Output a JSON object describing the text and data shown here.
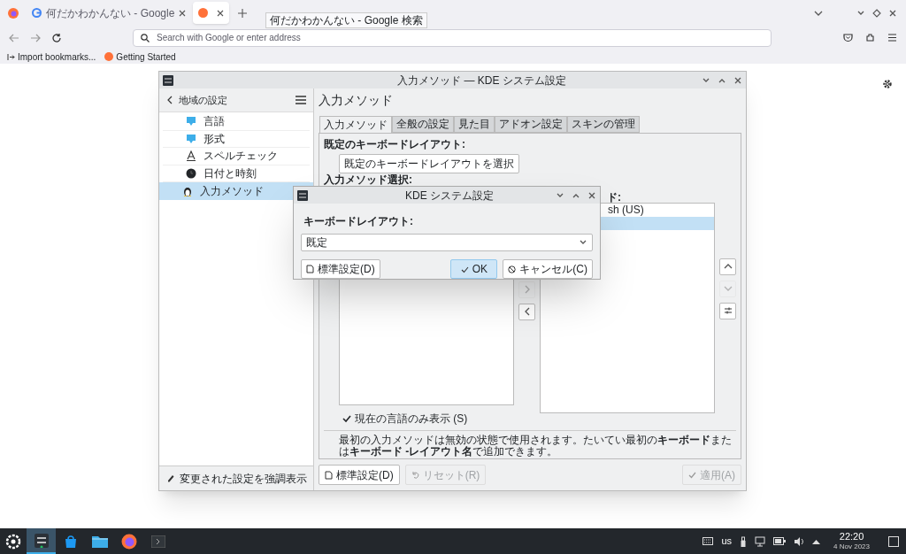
{
  "browser": {
    "tabs": [
      {
        "title": "何だかわかんない - Google",
        "selected": false
      },
      {
        "selected": true
      }
    ],
    "tooltip": "何だかわかんない - Google 検索",
    "address_bar": {
      "placeholder": "Search with Google or enter address"
    },
    "bookmarks": [
      "Import bookmarks...",
      "Getting Started"
    ]
  },
  "settings_window": {
    "title": "入力メソッド — KDE システム設定",
    "sidebar": {
      "title": "地域の設定",
      "items": [
        {
          "label": "言語",
          "kind": "speech",
          "selected": false
        },
        {
          "label": "形式",
          "kind": "speech",
          "selected": false
        },
        {
          "label": "スペルチェック",
          "kind": "spell",
          "selected": false
        },
        {
          "label": "日付と時刻",
          "kind": "clock",
          "selected": false
        },
        {
          "label": "入力メソッド",
          "kind": "penguin",
          "selected": true
        }
      ],
      "footer_button": "変更された設定を強調表示"
    },
    "page_title": "入力メソッド",
    "tabs": [
      {
        "label": "入力メソッド",
        "selected": true
      },
      {
        "label": "全般の設定",
        "selected": false
      },
      {
        "label": "見た目",
        "selected": false
      },
      {
        "label": "アドオン設定",
        "selected": false
      },
      {
        "label": "スキンの管理",
        "selected": false
      }
    ],
    "default_layout_label": "既定のキーボードレイアウト:",
    "select_layout_button": "既定のキーボードレイアウトを選択",
    "input_method_label": "入力メソッド選択:",
    "current_label": "ド:",
    "current_methods": [
      {
        "text": "sh (US)",
        "selected": false
      },
      {
        "selected": true
      }
    ],
    "add_button": {
      "disabled": true
    },
    "remove_button": {
      "disabled": false
    },
    "move_up_button": {
      "disabled": false
    },
    "move_down_button": {
      "disabled": true
    },
    "current_language_only": {
      "label": "現在の言語のみ表示 (S)",
      "checked": true
    },
    "info": "最初の入力メソッドは無効の状態で使用されます。たいてい最初の**キーボード**または**キーボード -レイアウト名**で追加できます。",
    "buttons": [
      {
        "label": "標準設定(D)",
        "kind": "defaults",
        "disabled": false
      },
      {
        "label": "リセット(R)",
        "kind": "reset",
        "disabled": true
      },
      {
        "label": "適用(A)",
        "kind": "apply",
        "disabled": true
      }
    ]
  },
  "dialog": {
    "title": "KDE システム設定",
    "layout_label": "キーボードレイアウト:",
    "layout_value": "既定",
    "buttons": [
      {
        "label": "標準設定(D)",
        "kind": "defaults",
        "default": false
      },
      {
        "label": "OK",
        "kind": "ok",
        "default": true
      },
      {
        "label": "キャンセル(C)",
        "kind": "cancel",
        "default": false
      }
    ]
  },
  "taskbar": {
    "tasks": [
      {
        "kind": "settings",
        "selected": true
      },
      {
        "kind": "store",
        "selected": false
      },
      {
        "kind": "files",
        "selected": false
      },
      {
        "kind": "firefox",
        "selected": false
      },
      {
        "kind": "terminal",
        "selected": false
      }
    ],
    "keyboard_layout": "us",
    "time": "22:20",
    "date": "4 Nov 2023"
  }
}
